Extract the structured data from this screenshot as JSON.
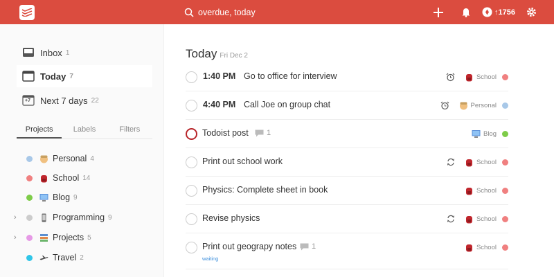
{
  "header": {
    "search_text": "overdue, today",
    "karma": "↑1756",
    "colors": {
      "brand": "#db4c3f"
    }
  },
  "sidebar": {
    "nav": [
      {
        "label": "Inbox",
        "count": "1",
        "icon": "inbox-icon"
      },
      {
        "label": "Today",
        "count": "7",
        "icon": "calendar-today-icon"
      },
      {
        "label": "Next 7 days",
        "count": "22",
        "icon": "calendar-week-icon"
      }
    ],
    "week_badge": "+7",
    "tabs": [
      {
        "label": "Projects"
      },
      {
        "label": "Labels"
      },
      {
        "label": "Filters"
      }
    ],
    "projects": [
      {
        "label": "Personal",
        "count": "4",
        "color": "#a8c8e8",
        "icon": "person-icon"
      },
      {
        "label": "School",
        "count": "14",
        "color": "#f08080",
        "icon": "backpack-icon"
      },
      {
        "label": "Blog",
        "count": "9",
        "color": "#7ecc49",
        "icon": "computer-icon"
      },
      {
        "label": "Programming",
        "count": "9",
        "color": "#cccccc",
        "icon": "phone-icon"
      },
      {
        "label": "Projects",
        "count": "5",
        "color": "#e69ae6",
        "icon": "books-icon"
      },
      {
        "label": "Travel",
        "count": "2",
        "color": "#30c6e8",
        "icon": "airplane-icon"
      }
    ]
  },
  "main": {
    "title": "Today",
    "date": "Fri Dec 2",
    "tasks": [
      {
        "time": "1:40 PM",
        "title": "Go to office for interview",
        "project": "School",
        "color": "#f08080",
        "icon": "backpack-icon",
        "extra": "alarm-icon"
      },
      {
        "time": "4:40 PM",
        "title": "Call Joe on group chat",
        "project": "Personal",
        "color": "#a8c8e8",
        "icon": "person-icon",
        "extra": "alarm-icon"
      },
      {
        "time": "",
        "title": "Todoist post",
        "comments": "1",
        "project": "Blog",
        "color": "#7ecc49",
        "icon": "computer-icon",
        "priority": true
      },
      {
        "time": "",
        "title": "Print out school work",
        "project": "School",
        "color": "#f08080",
        "icon": "backpack-icon",
        "extra": "repeat-icon"
      },
      {
        "time": "",
        "title": "Physics: Complete sheet in book",
        "project": "School",
        "color": "#f08080",
        "icon": "backpack-icon"
      },
      {
        "time": "",
        "title": "Revise physics",
        "project": "School",
        "color": "#f08080",
        "icon": "backpack-icon",
        "extra": "repeat-icon"
      },
      {
        "time": "",
        "title": "Print out geograpy notes",
        "comments": "1",
        "label": "waiting",
        "project": "School",
        "color": "#f08080",
        "icon": "backpack-icon"
      }
    ]
  }
}
